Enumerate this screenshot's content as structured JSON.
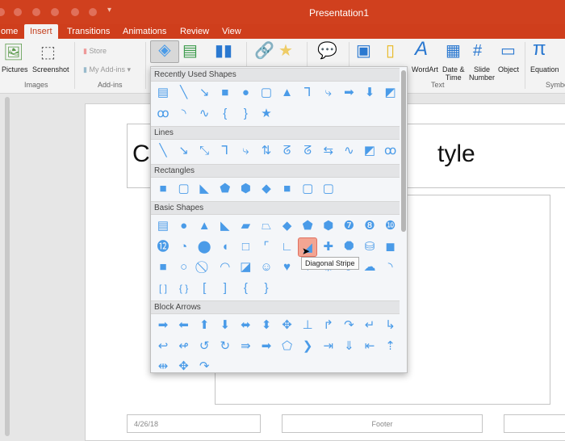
{
  "window": {
    "title": "Presentation1"
  },
  "tabs": [
    "ome",
    "Insert",
    "Transitions",
    "Animations",
    "Review",
    "View"
  ],
  "ribbon": {
    "pictures": "Pictures",
    "screenshot": "Screenshot",
    "store": "Store",
    "my_addins": "My Add-ins",
    "wordart": "WordArt",
    "date_time": "Date &\nTime",
    "slide_number": "Slide\nNumber",
    "object": "Object",
    "equation": "Equation",
    "groups": {
      "images": "Images",
      "addins": "Add-ins",
      "text": "Text",
      "symbols": "Symbo"
    }
  },
  "slide": {
    "title_left": "Cl",
    "title_right": "tyle",
    "date": "4/26/18",
    "footer": "Footer"
  },
  "shapes_panel": {
    "sections": [
      {
        "title": "Recently Used Shapes",
        "items": [
          "▤",
          "╲",
          "↘",
          "■",
          "●",
          "▢",
          "▲",
          "⅂",
          "⤷",
          "➡",
          "⬇",
          "◩",
          "ꝏ",
          "◝",
          "∿",
          "{",
          "}",
          "★"
        ]
      },
      {
        "title": "Lines",
        "items": [
          "╲",
          "↘",
          "⤡",
          "⅂",
          "⤷",
          "⇅",
          "ᘔ",
          "ᘔ",
          "⇆",
          "∿",
          "◩",
          "ꝏ"
        ]
      },
      {
        "title": "Rectangles",
        "items": [
          "■",
          "▢",
          "◣",
          "⬟",
          "⬢",
          "◆",
          "■",
          "▢",
          "▢"
        ]
      },
      {
        "title": "Basic Shapes",
        "items": [
          "▤",
          "●",
          "▲",
          "◣",
          "▰",
          "⏢",
          "◆",
          "⬟",
          "⬢",
          "❼",
          "❽",
          "❿",
          "⓬",
          "◔",
          "⬤",
          "◖",
          "□",
          "⌜",
          "∟",
          "◢",
          "✚",
          "⯃",
          "⛁",
          "◼",
          "■",
          "○",
          "⃠",
          "◠",
          "◪",
          "☺",
          "♥",
          "☀",
          "☼",
          "☾",
          "☁",
          "◝",
          "[ ]",
          "{ }",
          "[",
          "]",
          "{",
          "}"
        ]
      },
      {
        "title": "Block Arrows",
        "items": [
          "➡",
          "⬅",
          "⬆",
          "⬇",
          "⬌",
          "⬍",
          "✥",
          "⊥",
          "↱",
          "↷",
          "↵",
          "↳",
          "↩",
          "↫",
          "↺",
          "↻",
          "⇛",
          "➡",
          "⬠",
          "❯",
          "⇥",
          "⇓",
          "⇤",
          "⇡",
          "⇹",
          "✥",
          "↷"
        ]
      }
    ],
    "selected": "Diagonal Stripe",
    "selected_glyph": "◢",
    "tooltip": "Diagonal Stripe"
  },
  "colors": {
    "accent": "#d0401e",
    "shape": "#4a9be8",
    "selected_bg": "#f3a593"
  }
}
